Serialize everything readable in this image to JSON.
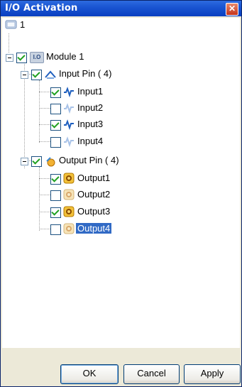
{
  "window": {
    "title": "I/O Activation",
    "close_glyph": "✕"
  },
  "tree": {
    "root_label": "1",
    "module": {
      "label": "Module 1",
      "badge": "I.O",
      "checked": true
    },
    "input_group": {
      "label": "Input Pin ( 4)",
      "checked": true
    },
    "inputs": [
      {
        "label": "Input1",
        "checked": true
      },
      {
        "label": "Input2",
        "checked": false
      },
      {
        "label": "Input3",
        "checked": true
      },
      {
        "label": "Input4",
        "checked": false
      }
    ],
    "output_group": {
      "label": "Output Pin ( 4)",
      "checked": true
    },
    "outputs": [
      {
        "label": "Output1",
        "checked": true
      },
      {
        "label": "Output2",
        "checked": false
      },
      {
        "label": "Output3",
        "checked": true
      },
      {
        "label": "Output4",
        "checked": false,
        "selected": true
      }
    ]
  },
  "buttons": {
    "ok": "OK",
    "cancel": "Cancel",
    "apply": "Apply"
  },
  "colors": {
    "titlebar": "#1a55d2",
    "selection": "#316ac5",
    "check": "#21a121"
  }
}
